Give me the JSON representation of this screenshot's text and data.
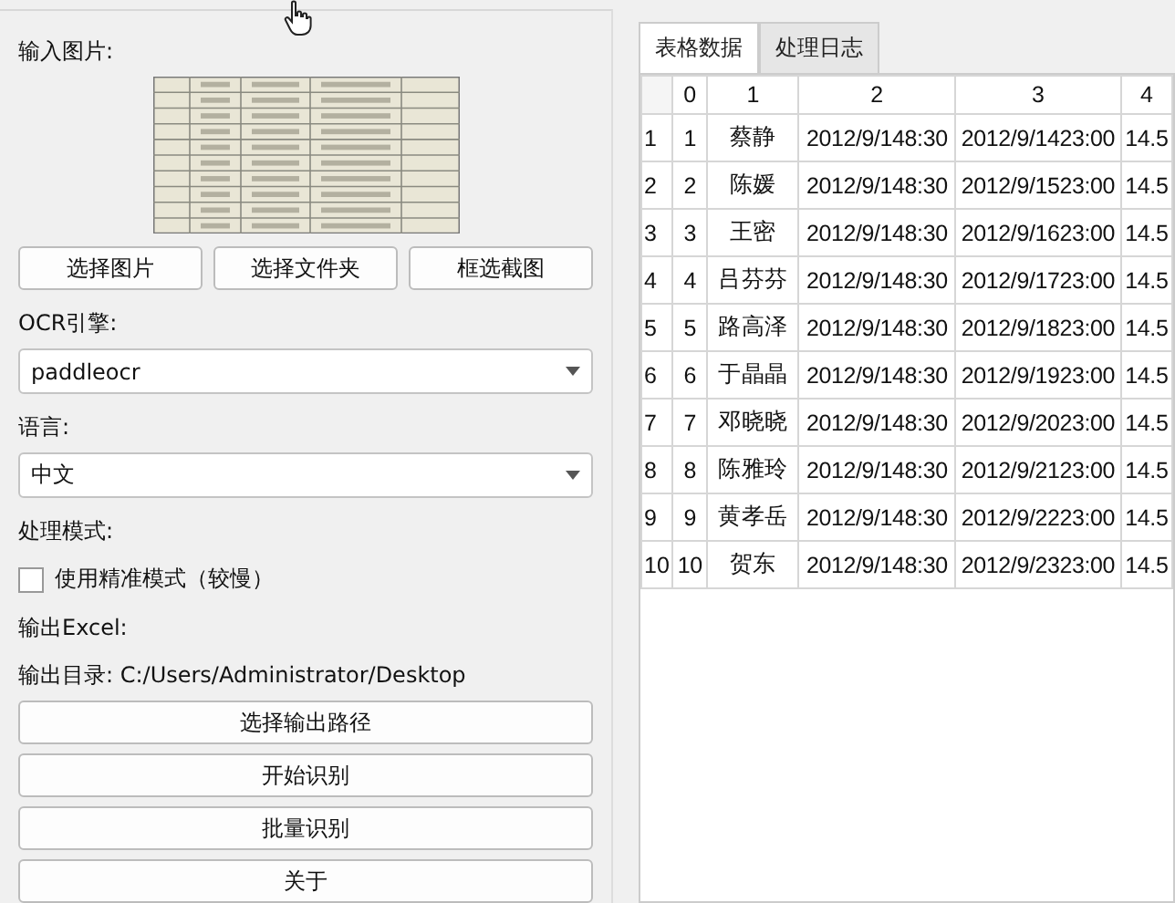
{
  "left_panel": {
    "input_label": "输入图片:",
    "image": {
      "kind": "picture"
    },
    "image_buttons": [
      "选择图片",
      "选择文件夹",
      "框选截图"
    ],
    "ocr_label": "OCR引擎:",
    "ocr_engine": {
      "value": "paddleocr"
    },
    "language_label": "语言:",
    "language": {
      "value": "中文"
    },
    "mode_label": "处理模式:",
    "precise_mode": {
      "label": "使用精准模式（较慢）",
      "checked": false
    },
    "excel_label": "输出Excel:",
    "output_dir": "输出目录: C:/Users/Administrator/Desktop",
    "action_buttons": [
      "选择输出路径",
      "开始识别",
      "批量识别",
      "关于"
    ]
  },
  "tabs": [
    {
      "label": "表格数据",
      "selected": true
    },
    {
      "label": "处理日志",
      "selected": false
    }
  ],
  "table": {
    "columns": [
      "0",
      "1",
      "2",
      "3",
      "4"
    ],
    "rows": [
      {
        "header": "1",
        "cells": [
          "1",
          "蔡静",
          "2012/9/148:30",
          "2012/9/1423:00",
          "14.5"
        ]
      },
      {
        "header": "2",
        "cells": [
          "2",
          "陈媛",
          "2012/9/148:30",
          "2012/9/1523:00",
          "14.5"
        ]
      },
      {
        "header": "3",
        "cells": [
          "3",
          "王密",
          "2012/9/148:30",
          "2012/9/1623:00",
          "14.5"
        ]
      },
      {
        "header": "4",
        "cells": [
          "4",
          "吕芬芬",
          "2012/9/148:30",
          "2012/9/1723:00",
          "14.5"
        ]
      },
      {
        "header": "5",
        "cells": [
          "5",
          "路高泽",
          "2012/9/148:30",
          "2012/9/1823:00",
          "14.5"
        ]
      },
      {
        "header": "6",
        "cells": [
          "6",
          "于晶晶",
          "2012/9/148:30",
          "2012/9/1923:00",
          "14.5"
        ]
      },
      {
        "header": "7",
        "cells": [
          "7",
          "邓晓晓",
          "2012/9/148:30",
          "2012/9/2023:00",
          "14.5"
        ]
      },
      {
        "header": "8",
        "cells": [
          "8",
          "陈雅玲",
          "2012/9/148:30",
          "2012/9/2123:00",
          "14.5"
        ]
      },
      {
        "header": "9",
        "cells": [
          "9",
          "黄孝岳",
          "2012/9/148:30",
          "2012/9/2223:00",
          "14.5"
        ]
      },
      {
        "header": "10",
        "cells": [
          "10",
          "贺东",
          "2012/9/148:30",
          "2012/9/2323:00",
          "14.5"
        ]
      }
    ]
  }
}
